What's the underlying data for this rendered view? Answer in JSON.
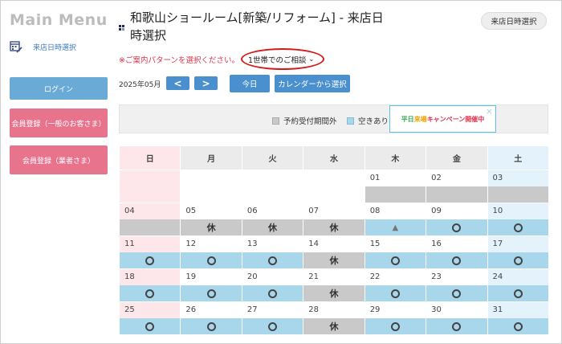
{
  "sidebar": {
    "title": "Main Menu",
    "link_label": "来店日時選択",
    "buttons": {
      "login": "ログイン",
      "register_general": "会員登録（一般のお客さま）",
      "register_business": "会員登録（業者さま）"
    }
  },
  "header": {
    "title": "和歌山ショールーム[新築/リフォーム] - 来店日時選択",
    "top_button": "来店日時選択",
    "notice": "※ご案内パターンを選択ください。",
    "pattern_selected": "1世帯でのご相談"
  },
  "controls": {
    "month": "2025年05月",
    "prev": "<",
    "next": ">",
    "today": "今日",
    "from_calendar": "カレンダーから選択"
  },
  "legend": {
    "outside_period": "予約受付期間外",
    "available": "空きあり"
  },
  "campaign": {
    "part1": "平日",
    "part2": "来場",
    "part3": "キャンペーン開催中",
    "close": "×"
  },
  "calendar": {
    "weekdays": [
      "日",
      "月",
      "火",
      "水",
      "木",
      "金",
      "土"
    ],
    "weeks": [
      [
        {
          "day": "",
          "status": "blank"
        },
        {
          "day": "",
          "status": "blank"
        },
        {
          "day": "",
          "status": "blank"
        },
        {
          "day": "",
          "status": "blank"
        },
        {
          "day": "01",
          "status": "none"
        },
        {
          "day": "02",
          "status": "none"
        },
        {
          "day": "03",
          "status": "none"
        }
      ],
      [
        {
          "day": "04",
          "status": "none"
        },
        {
          "day": "05",
          "status": "closed",
          "label": "休"
        },
        {
          "day": "06",
          "status": "closed",
          "label": "休"
        },
        {
          "day": "07",
          "status": "closed",
          "label": "休"
        },
        {
          "day": "08",
          "status": "limited",
          "label": "▲"
        },
        {
          "day": "09",
          "status": "available"
        },
        {
          "day": "10",
          "status": "available"
        }
      ],
      [
        {
          "day": "11",
          "status": "available"
        },
        {
          "day": "12",
          "status": "available"
        },
        {
          "day": "13",
          "status": "available"
        },
        {
          "day": "14",
          "status": "closed",
          "label": "休"
        },
        {
          "day": "15",
          "status": "available"
        },
        {
          "day": "16",
          "status": "available"
        },
        {
          "day": "17",
          "status": "available"
        }
      ],
      [
        {
          "day": "18",
          "status": "available"
        },
        {
          "day": "19",
          "status": "available"
        },
        {
          "day": "20",
          "status": "available"
        },
        {
          "day": "21",
          "status": "closed",
          "label": "休"
        },
        {
          "day": "22",
          "status": "available"
        },
        {
          "day": "23",
          "status": "available"
        },
        {
          "day": "24",
          "status": "available"
        }
      ],
      [
        {
          "day": "25",
          "status": "available"
        },
        {
          "day": "26",
          "status": "available"
        },
        {
          "day": "27",
          "status": "available"
        },
        {
          "day": "28",
          "status": "closed",
          "label": "休"
        },
        {
          "day": "29",
          "status": "available"
        },
        {
          "day": "30",
          "status": "available"
        },
        {
          "day": "31",
          "status": "available"
        }
      ]
    ]
  },
  "colors": {
    "accent_blue": "#4a90cf",
    "pink_button": "#e7738d",
    "available": "#a8d7ec",
    "closed": "#c9c9c9",
    "highlight_red": "#d61a1a"
  }
}
